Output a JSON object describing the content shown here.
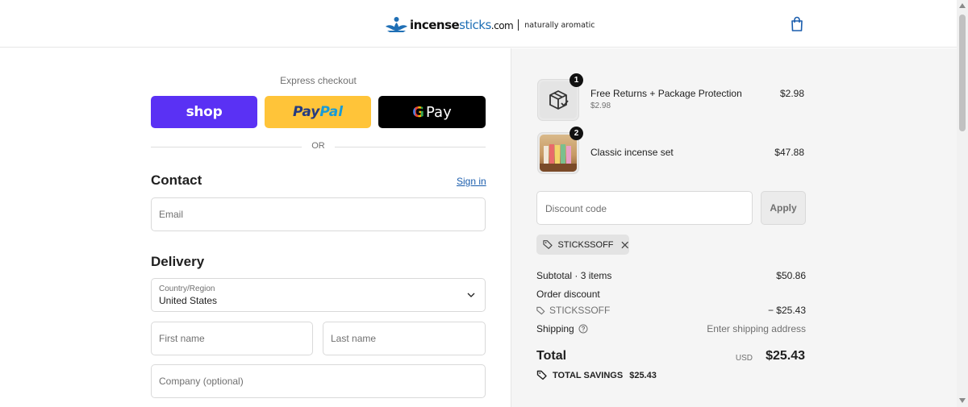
{
  "header": {
    "logo": {
      "part1": "incense",
      "part2": "sticks",
      "part3": ".com",
      "tagline": "naturally aromatic"
    },
    "cart_icon": "shopping-bag-icon"
  },
  "express": {
    "title": "Express checkout",
    "shop_label": "shop",
    "paypal_part1": "Pay",
    "paypal_part2": "Pal",
    "gpay_g": "G",
    "gpay_label": "Pay",
    "or_label": "OR"
  },
  "contact": {
    "title": "Contact",
    "sign_in": "Sign in",
    "email_placeholder": "Email"
  },
  "delivery": {
    "title": "Delivery",
    "country_label": "Country/Region",
    "country_value": "United States",
    "first_name_placeholder": "First name",
    "last_name_placeholder": "Last name",
    "company_placeholder": "Company (optional)"
  },
  "order": {
    "items": [
      {
        "name": "Free Returns + Package Protection",
        "sub": "$2.98",
        "price": "$2.98",
        "qty": "1"
      },
      {
        "name": "Classic incense set",
        "sub": "",
        "price": "$47.88",
        "qty": "2"
      }
    ],
    "discount_placeholder": "Discount code",
    "apply_label": "Apply",
    "applied_code": "STICKSSOFF",
    "subtotal_label": "Subtotal · 3 items",
    "subtotal_value": "$50.86",
    "order_discount_label": "Order discount",
    "discount_code": "STICKSSOFF",
    "discount_value": "− $25.43",
    "shipping_label": "Shipping",
    "shipping_value": "Enter shipping address",
    "total_label": "Total",
    "currency": "USD",
    "total_value": "$25.43",
    "savings_label": "TOTAL SAVINGS",
    "savings_value": "$25.43"
  },
  "colors": {
    "shop": "#5a31f4",
    "paypal": "#ffc439",
    "gpay": "#000000",
    "link": "#1a5dad",
    "summary_bg": "#f5f5f5"
  }
}
